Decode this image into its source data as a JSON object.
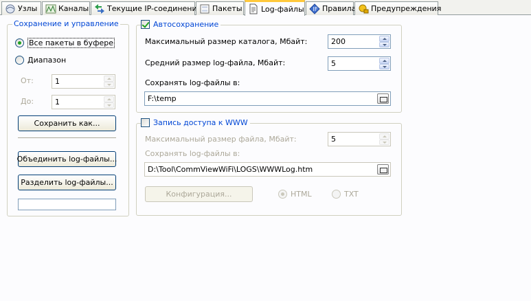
{
  "tabs": [
    {
      "label": "Узлы",
      "icon": "nodes-icon"
    },
    {
      "label": "Каналы",
      "icon": "channels-icon"
    },
    {
      "label": "Текущие IP-соединения",
      "icon": "ip-connections-icon"
    },
    {
      "label": "Пакеты",
      "icon": "packets-icon"
    },
    {
      "label": "Log-файлы",
      "icon": "log-files-icon",
      "active": true
    },
    {
      "label": "Правила",
      "icon": "rules-icon"
    },
    {
      "label": "Предупреждения",
      "icon": "alerts-icon"
    }
  ],
  "save_group": {
    "title": "Сохранение и управление",
    "radio_all": "Все пакеты в буфере",
    "radio_range": "Диапазон",
    "from_label": "От:",
    "from_value": "1",
    "to_label": "До:",
    "to_value": "1",
    "save_as_button": "Сохранить как...",
    "merge_button": "Объединить log-файлы...",
    "split_button": "Разделить log-файлы..."
  },
  "autosave": {
    "title": "Автосохранение",
    "checked": true,
    "max_dir_label": "Максимальный размер каталога, Мбайт:",
    "max_dir_value": "200",
    "avg_file_label": "Средний размер log-файла, Мбайт:",
    "avg_file_value": "5",
    "save_to_label": "Сохранять log-файлы в:",
    "save_to_value": "F:\\temp"
  },
  "www": {
    "title": "Запись доступа к WWW",
    "checked": false,
    "max_file_label": "Максимальный размер файла, Мбайт:",
    "max_file_value": "5",
    "save_to_label": "Сохранять log-файлы в:",
    "save_to_value": "D:\\Tool\\CommViewWiFi\\LOGS\\WWWLog.htm",
    "config_button": "Конфигурация...",
    "format_html": "HTML",
    "format_txt": "TXT"
  },
  "colors": {
    "legend": "#0046d5",
    "active_tab_accent": "#ffc83c",
    "check_green": "#21a121"
  }
}
